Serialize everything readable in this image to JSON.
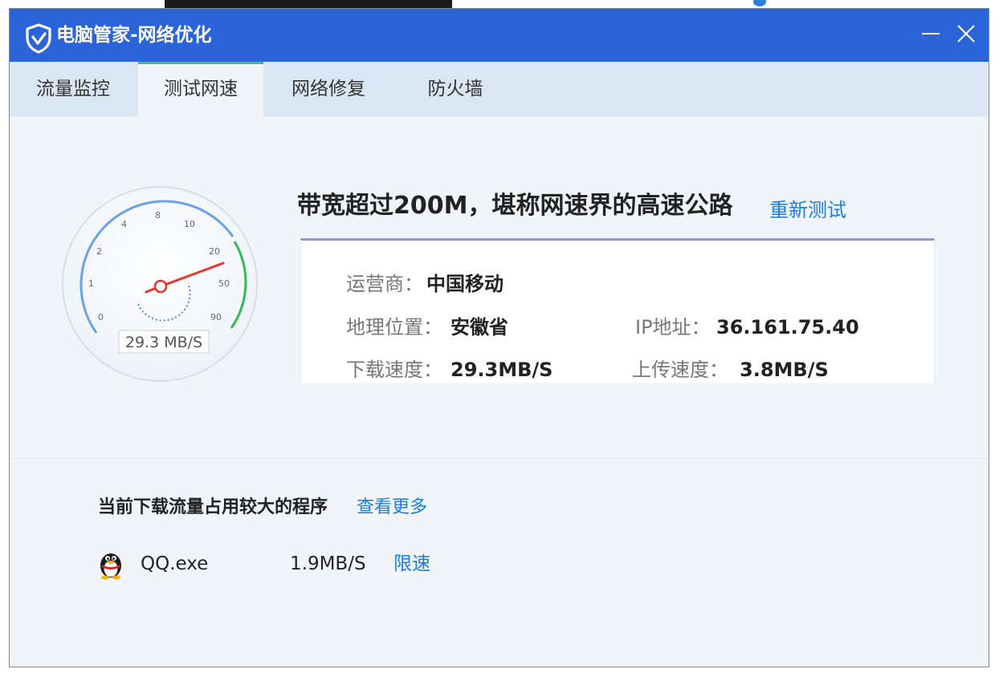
{
  "window": {
    "title": "电脑管家-网络优化",
    "brand_color": "#2b63d9",
    "accent_tab_color": "#34c76a",
    "link_color": "#1a7ce8"
  },
  "tabs": [
    {
      "label": "流量监控",
      "active": false
    },
    {
      "label": "测试网速",
      "active": true
    },
    {
      "label": "网络修复",
      "active": false
    },
    {
      "label": "防火墙",
      "active": false
    }
  ],
  "gauge": {
    "ticks": [
      "0",
      "1",
      "2",
      "4",
      "8",
      "10",
      "20",
      "50",
      "90"
    ],
    "readout": "29.3 MB/S"
  },
  "result": {
    "headline": "带宽超过200M，堪称网速界的高速公路",
    "retest_label": "重新测试",
    "isp_label": "运营商：",
    "isp_value": "中国移动",
    "location_label": "地理位置：",
    "location_value": "安徽省",
    "ip_label": "IP地址：",
    "ip_value": "36.161.75.40",
    "download_label": "下载速度：",
    "download_value": "29.3MB/S",
    "upload_label": "上传速度：",
    "upload_value": "3.8MB/S"
  },
  "programs": {
    "title": "当前下载流量占用较大的程序",
    "see_more_label": "查看更多",
    "items": [
      {
        "icon": "qq-penguin-icon",
        "name": "QQ.exe",
        "speed": "1.9MB/S",
        "action": "限速"
      }
    ]
  },
  "icons": {
    "app": "shield-icon",
    "minimize": "minimize-icon",
    "close": "close-icon"
  }
}
